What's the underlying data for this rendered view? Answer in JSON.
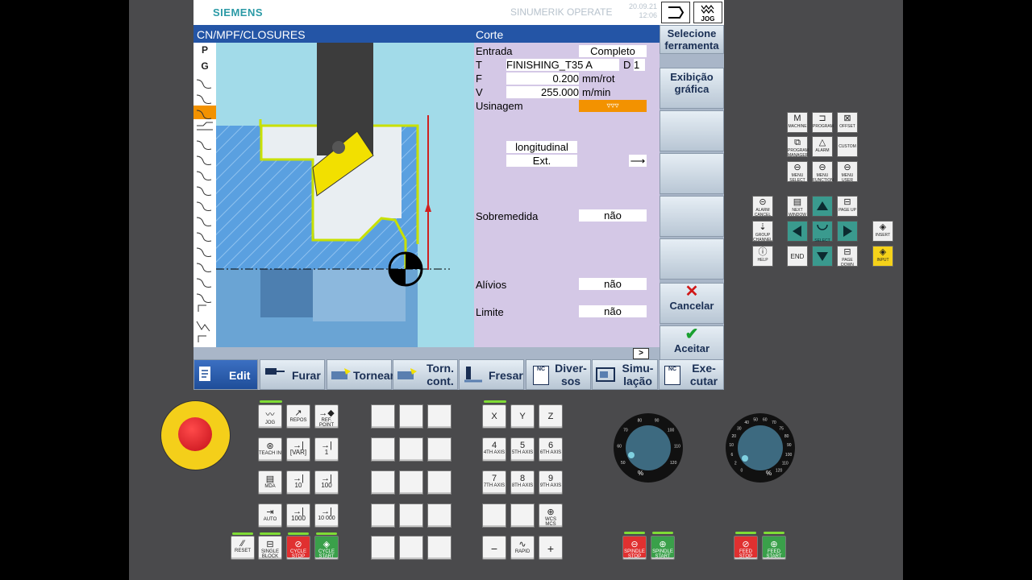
{
  "header": {
    "brand": "SIEMENS",
    "product": "SINUMERIK OPERATE",
    "date": "20.09.21",
    "time": "12:06",
    "mode_label": "JOG"
  },
  "pathbar": {
    "path": "CN/MPF/CLOSURES",
    "title": "Corte"
  },
  "strip": {
    "labels": [
      "P",
      "G"
    ]
  },
  "form": {
    "entrada_label": "Entrada",
    "entrada_value": "Completo",
    "t_label": "T",
    "t_value": "FINISHING_T35 A",
    "d_label": "D",
    "d_value": "1",
    "f_label": "F",
    "f_value": "0.200",
    "f_unit": "mm/rot",
    "v_label": "V",
    "v_value": "255.000",
    "v_unit": "m/min",
    "usinagem_label": "Usinagem",
    "usinagem_value": "▿▿▿",
    "direction_value": "longitudinal",
    "position_value": "Ext.",
    "direction_arrow": "⟶",
    "sobremedida_label": "Sobremedida",
    "sobremedida_value": "não",
    "alivios_label": "Alívios",
    "alivios_value": "não",
    "limite_label": "Limite",
    "limite_value": "não",
    "more_label": ">"
  },
  "right_softkeys": {
    "select_tool": "Selecione ferramenta",
    "graphic_view": "Exibição gráfica",
    "cancel": "Cancelar",
    "accept": "Aceitar"
  },
  "bottom_softkeys": [
    "Edit",
    "Furar",
    "Tornear",
    "Torn. cont.",
    "Fresar",
    "Diver- sos",
    "Simu- lação",
    "Exe- cutar"
  ],
  "nc_label": "NC",
  "keypad": {
    "mode_keys": [
      {
        "main": "",
        "sub": "JOG"
      },
      {
        "main": "",
        "sub": "REPOS"
      },
      {
        "main": "",
        "sub": "REF. POINT"
      },
      {
        "main": "",
        "sub": "TEACH IN"
      },
      {
        "main": "[VAR]",
        "sub": ""
      },
      {
        "main": "1",
        "sub": ""
      },
      {
        "main": "",
        "sub": "MDA"
      },
      {
        "main": "10",
        "sub": ""
      },
      {
        "main": "100",
        "sub": ""
      },
      {
        "main": "",
        "sub": "AUTO"
      },
      {
        "main": "1000",
        "sub": ""
      },
      {
        "main": "10 000",
        "sub": ""
      }
    ],
    "control_keys": [
      "RESET",
      "SINGLE BLOCK",
      "CYCLE STOP",
      "CYCLE START"
    ],
    "axis_keys": [
      {
        "main": "X",
        "sub": ""
      },
      {
        "main": "Y",
        "sub": ""
      },
      {
        "main": "Z",
        "sub": ""
      },
      {
        "main": "4",
        "sub": "4TH AXIS"
      },
      {
        "main": "5",
        "sub": "5TH AXIS"
      },
      {
        "main": "6",
        "sub": "6TH AXIS"
      },
      {
        "main": "7",
        "sub": "7TH AXIS"
      },
      {
        "main": "8",
        "sub": "8TH AXIS"
      },
      {
        "main": "9",
        "sub": "9TH AXIS"
      },
      {
        "main": "",
        "sub": ""
      },
      {
        "main": "",
        "sub": ""
      },
      {
        "main": "",
        "sub": "WCS MCS"
      },
      {
        "main": "−",
        "sub": ""
      },
      {
        "main": "",
        "sub": "RAPID"
      },
      {
        "main": "+",
        "sub": ""
      }
    ],
    "spindle_keys": [
      "SPINDLE STOP",
      "SPINDLE START"
    ],
    "feed_keys": [
      "FEED STOP",
      "FEED START"
    ],
    "spindle_dial": {
      "ticks": [
        "50",
        "60",
        "70",
        "80",
        "90",
        "100",
        "110",
        "120"
      ],
      "unit": "%"
    },
    "feed_dial": {
      "ticks": [
        "0",
        "2",
        "6",
        "10",
        "20",
        "30",
        "40",
        "50",
        "60",
        "70",
        "75",
        "80",
        "90",
        "100",
        "110",
        "120"
      ],
      "unit": "%"
    }
  },
  "nav_keys": {
    "top": [
      "MACHINE",
      "PROGRAM",
      "OFFSET",
      "PROGRAM MANAGER",
      "ALARM",
      "CUSTOM",
      "MENU SELECT",
      "MENU FUNCTION",
      "MENU USER"
    ],
    "row1": [
      "ALARM CANCEL",
      "NEXT WINDOW",
      "",
      "PAGE UP"
    ],
    "row2": [
      "GROUP CHANNEL",
      "",
      "SELECT",
      ""
    ],
    "row3": [
      "HELP",
      "END",
      "",
      "PAGE DOWN"
    ],
    "end_label": "END",
    "insert": "INSERT",
    "input": "INPUT"
  },
  "colors": {
    "accent": "#2455a6",
    "highlight": "#f39200",
    "form_bg": "#d4c8e6",
    "graphic_bg": "#a2dbe9",
    "panel": "#4a4a4c"
  }
}
